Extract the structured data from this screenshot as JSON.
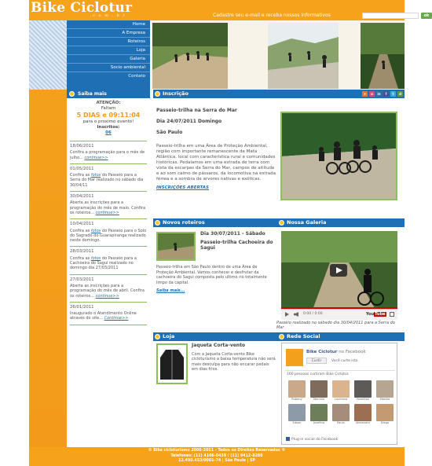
{
  "header": {
    "logo": "Bike Ciclotur",
    "logo_sub": ".c o m . b r",
    "newsletter_label": "Cadastre seu e-mail e receba nossos informativos",
    "newsletter_button": "ok"
  },
  "nav": {
    "items": [
      {
        "label": "Home"
      },
      {
        "label": "A Empresa"
      },
      {
        "label": "Roteiros"
      },
      {
        "label": "Loja"
      },
      {
        "label": "Galeria"
      },
      {
        "label": "Socio ambiental"
      },
      {
        "label": "Contato"
      }
    ]
  },
  "sidebar": {
    "title": "Saiba mais",
    "attention": "ATENÇÃO:",
    "faltam": "Faltam",
    "countdown": "5 DIAS e 09:11:04",
    "next_event": "para o proximo evento!",
    "inscritos_label": "Inscritos:",
    "inscritos_value": "06",
    "news": [
      {
        "date": "18/06/2011",
        "text": "Confira a programação para o mês de julho...",
        "link": "continue>>"
      },
      {
        "date": "01/05/2011",
        "text_a": "Confira as",
        "link_a": "fotos",
        "text_b": "do Passeio para a Serra do Mar realizado no sábado dia 30/04/11"
      },
      {
        "date": "30/04/2011",
        "text": "Aberta as inscrições para a programação do mês de maio. Confira os roteiros...",
        "link": "continue>>"
      },
      {
        "date": "10/04/2011",
        "text_a": "Confira as",
        "link_a": "fotos",
        "text_b": "do Passeio para o Solo do Sagrado do Guarapiranga realizado neste domingo."
      },
      {
        "date": "28/03/2011",
        "text_a": "Confira as",
        "link_a": "fotos",
        "text_b": "do Passeio para a Cachoeira do Sagui realizado no domingo dia 27/03/2011"
      },
      {
        "date": "27/03/2011",
        "text": "Aberta as inscrições para a programação do mês de abril. Confira os roteiros...",
        "link": "continue>>"
      },
      {
        "date": "26/01/2011",
        "text": "Inaugurado o Atendimento Online através do site...",
        "link": "Continue>>"
      }
    ]
  },
  "inscricao": {
    "title": "Inscrição",
    "headline": "Passeio-trilha na Serra do Mar",
    "date": "Dia 24/07/2011 Domingo",
    "place": "São Paulo",
    "description": "Passeio-trilha em uma Área de Proteção Ambiental, região com importante remanescente de Mata Atlântica, local com característica rural e comunidades históricas. Pedalamos em uma estrada de terra com vista da escarpas da Serra do Mar, campos de altitude e ao som calmo de pássaros, da locomotiva na estrada férrea e a sombra de arvores nativas e exóticas.",
    "link": "INSCRIÇÕES ABERTAS",
    "social_icons": [
      "plus-icon",
      "orkut-icon",
      "linkedin-icon",
      "facebook-icon",
      "twitter-icon",
      "delicious-icon"
    ]
  },
  "roteiros": {
    "title": "Novos roteiros",
    "date": "Dia 30/07/2011 - Sábado",
    "name": "Passeio-trilha Cachoeira do Sagui",
    "description": "Passeio-trilha em São Paulo dentro de uma Área de Proteção Ambiental. Vamos conhecer e desfrutar da cachoeira do Sagui composta pelo ultimo rio totalmente limpo da capital.",
    "link": "Saiba mais..."
  },
  "galeria": {
    "title": "Nossa Galeria",
    "time": "0:00 / 0:00",
    "caption": "Passeio realizado no sábado dia 30/04/2011 para a Serra do Mar"
  },
  "loja": {
    "title": "Loja",
    "product": "Jaqueta Corta-vento",
    "description": "Com a Jaqueta Corta-vento Bike cicloturismo a baixa temperatura não será mais desculpa para não encarar pedais em dias frios."
  },
  "rede": {
    "title": "Rede Social",
    "page_name": "Bike Ciclotur",
    "page_suffix": "no Facebook",
    "like_button": "Curtir",
    "like_text": "Você curte isto.",
    "count_text": "160 pessoas curtiram Bike Ciclotur.",
    "fans": [
      {
        "name": "Rubeny",
        "color": "#caa88a"
      },
      {
        "name": "Marcelo",
        "color": "#7f6b5b"
      },
      {
        "name": "Luciriana",
        "color": "#d9b48f"
      },
      {
        "name": "Hamilton",
        "color": "#5d5a58"
      },
      {
        "name": "Martha",
        "color": "#b6a58f"
      },
      {
        "name": "Edson",
        "color": "#8d9aa8"
      },
      {
        "name": "Josefina",
        "color": "#6d7f5a"
      },
      {
        "name": "Paulo",
        "color": "#a58d7a"
      },
      {
        "name": "Alexandre",
        "color": "#9c6f52"
      },
      {
        "name": "Diego",
        "color": "#c49a73"
      }
    ],
    "plugin": "Plug-in social do Facebook"
  },
  "footer": {
    "line1": "© Bike cicloturismo 2006-2011 - Todos os Direitos Reservados ®",
    "line2": "Telefones: (11) 4106-0439 / (11) 9412-8288",
    "line3": "12.490.453/0001-74 | São Paulo | SP"
  },
  "colors": {
    "orange": "#f7a21b",
    "blue": "#1f6fb5",
    "green_border": "#8fbf5c"
  }
}
